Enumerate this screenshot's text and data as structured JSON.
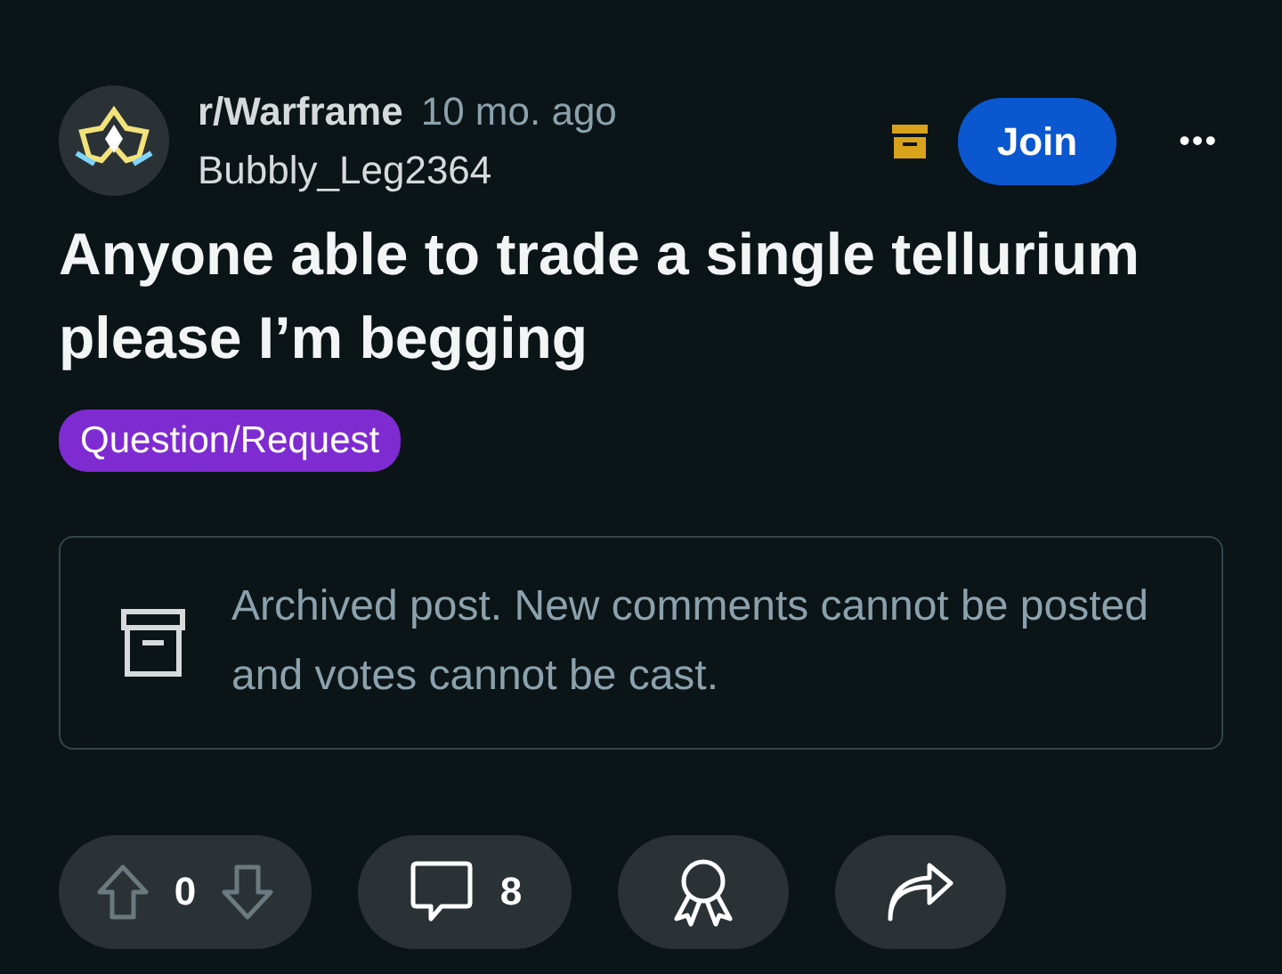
{
  "post": {
    "subreddit": "r/Warframe",
    "age": "10 mo. ago",
    "author": "Bubbly_Leg2364",
    "join_label": "Join",
    "more": "•••",
    "title": "Anyone able to trade a single tellurium please I’m begging",
    "flair": {
      "label": "Question/Request",
      "color": "#7e2bd1"
    }
  },
  "archive_notice": "Archived post. New comments cannot be posted and votes cannot be cast.",
  "actions": {
    "score": "0",
    "voting_disabled": true,
    "comments": "8"
  }
}
